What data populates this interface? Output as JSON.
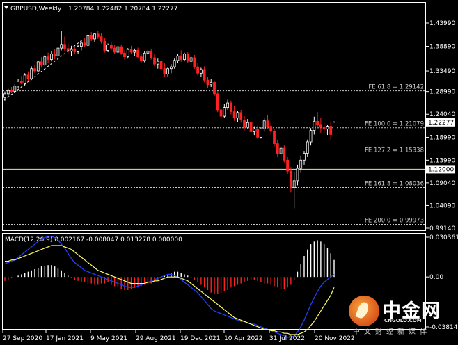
{
  "header": {
    "symbol_timeframe": "GBPUSD,Weekly",
    "ohlc": "1.20784 1.22482 1.20784 1.22277"
  },
  "price_axis": {
    "ticks": [
      "1.43990",
      "1.38890",
      "1.33490",
      "1.28990",
      "1.24040",
      "1.18990",
      "1.13990",
      "1.09040",
      "1.04090",
      "0.99140"
    ],
    "current_price_label": "1.22277",
    "line_label": "1.12000"
  },
  "fe_levels": [
    {
      "label": "FE 61.8 = 1.29142",
      "price": 1.29142
    },
    {
      "label": "FE 100.0 = 1.21079",
      "price": 1.21079
    },
    {
      "label": "FE 127.2 = 1.15338",
      "price": 1.15338
    },
    {
      "label": "FE 161.8 = 1.08036",
      "price": 1.08036
    },
    {
      "label": "FE 200.0 = 0.99973",
      "price": 0.99973
    }
  ],
  "horizontal_line": {
    "price": 1.12,
    "color": "#f4e2a0"
  },
  "macd": {
    "label": "MACD(12,26,9) 0.002167 -0.008047 0.013278 0.000000",
    "ticks": [
      "0.030361",
      "0.00",
      "-0.038141"
    ]
  },
  "time_axis": {
    "labels": [
      "27 Sep 2020",
      "17 Jan 2021",
      "9 May 2021",
      "29 Aug 2021",
      "19 Dec 2021",
      "10 Apr 2022",
      "31 Jul 2022",
      "20 Nov 2022"
    ]
  },
  "watermark": {
    "name": "中金网",
    "domain": "CNGOLD.COM",
    "tagline": "中文财经新媒体"
  },
  "colors": {
    "bull": "#ffffff",
    "bear": "#ff2020",
    "signal": "#ffff66",
    "macd_line": "#2040ff",
    "fe_line": "#c8c8c8",
    "grid": "#ffffff"
  },
  "chart_data": {
    "type": "candlestick",
    "candles": [
      [
        1.277,
        1.29,
        1.27,
        1.285
      ],
      [
        1.285,
        1.296,
        1.28,
        1.292
      ],
      [
        1.292,
        1.3,
        1.287,
        1.29
      ],
      [
        1.29,
        1.306,
        1.286,
        1.302
      ],
      [
        1.302,
        1.318,
        1.297,
        1.312
      ],
      [
        1.312,
        1.324,
        1.305,
        1.308
      ],
      [
        1.308,
        1.33,
        1.303,
        1.326
      ],
      [
        1.326,
        1.334,
        1.312,
        1.318
      ],
      [
        1.318,
        1.345,
        1.315,
        1.34
      ],
      [
        1.34,
        1.349,
        1.33,
        1.335
      ],
      [
        1.335,
        1.358,
        1.332,
        1.355
      ],
      [
        1.355,
        1.365,
        1.342,
        1.348
      ],
      [
        1.348,
        1.37,
        1.345,
        1.366
      ],
      [
        1.366,
        1.375,
        1.352,
        1.36
      ],
      [
        1.36,
        1.378,
        1.356,
        1.372
      ],
      [
        1.372,
        1.383,
        1.36,
        1.368
      ],
      [
        1.368,
        1.388,
        1.364,
        1.385
      ],
      [
        1.385,
        1.422,
        1.38,
        1.393
      ],
      [
        1.393,
        1.41,
        1.378,
        1.384
      ],
      [
        1.384,
        1.395,
        1.372,
        1.378
      ],
      [
        1.378,
        1.39,
        1.368,
        1.382
      ],
      [
        1.382,
        1.388,
        1.373,
        1.377
      ],
      [
        1.377,
        1.392,
        1.372,
        1.389
      ],
      [
        1.389,
        1.4,
        1.38,
        1.396
      ],
      [
        1.396,
        1.408,
        1.388,
        1.391
      ],
      [
        1.391,
        1.415,
        1.388,
        1.412
      ],
      [
        1.412,
        1.42,
        1.4,
        1.405
      ],
      [
        1.405,
        1.418,
        1.398,
        1.416
      ],
      [
        1.416,
        1.422,
        1.405,
        1.41
      ],
      [
        1.41,
        1.418,
        1.395,
        1.4
      ],
      [
        1.4,
        1.408,
        1.375,
        1.38
      ],
      [
        1.38,
        1.395,
        1.376,
        1.392
      ],
      [
        1.392,
        1.398,
        1.38,
        1.385
      ],
      [
        1.385,
        1.392,
        1.372,
        1.376
      ],
      [
        1.376,
        1.39,
        1.372,
        1.388
      ],
      [
        1.388,
        1.392,
        1.37,
        1.374
      ],
      [
        1.374,
        1.38,
        1.36,
        1.366
      ],
      [
        1.366,
        1.385,
        1.362,
        1.382
      ],
      [
        1.382,
        1.39,
        1.372,
        1.376
      ],
      [
        1.376,
        1.384,
        1.368,
        1.38
      ],
      [
        1.38,
        1.386,
        1.362,
        1.366
      ],
      [
        1.366,
        1.372,
        1.352,
        1.358
      ],
      [
        1.358,
        1.378,
        1.354,
        1.374
      ],
      [
        1.374,
        1.384,
        1.368,
        1.378
      ],
      [
        1.378,
        1.382,
        1.36,
        1.364
      ],
      [
        1.364,
        1.372,
        1.345,
        1.35
      ],
      [
        1.35,
        1.362,
        1.34,
        1.356
      ],
      [
        1.356,
        1.36,
        1.335,
        1.34
      ],
      [
        1.34,
        1.352,
        1.322,
        1.328
      ],
      [
        1.328,
        1.344,
        1.323,
        1.34
      ],
      [
        1.34,
        1.35,
        1.33,
        1.344
      ],
      [
        1.344,
        1.362,
        1.34,
        1.358
      ],
      [
        1.358,
        1.372,
        1.352,
        1.368
      ],
      [
        1.368,
        1.38,
        1.355,
        1.36
      ],
      [
        1.36,
        1.375,
        1.356,
        1.372
      ],
      [
        1.372,
        1.376,
        1.352,
        1.356
      ],
      [
        1.356,
        1.368,
        1.348,
        1.364
      ],
      [
        1.364,
        1.37,
        1.34,
        1.344
      ],
      [
        1.344,
        1.352,
        1.325,
        1.33
      ],
      [
        1.33,
        1.342,
        1.322,
        1.338
      ],
      [
        1.338,
        1.345,
        1.31,
        1.315
      ],
      [
        1.315,
        1.322,
        1.298,
        1.305
      ],
      [
        1.305,
        1.318,
        1.3,
        1.31
      ],
      [
        1.31,
        1.314,
        1.28,
        1.285
      ],
      [
        1.285,
        1.29,
        1.245,
        1.25
      ],
      [
        1.25,
        1.258,
        1.23,
        1.236
      ],
      [
        1.236,
        1.262,
        1.232,
        1.255
      ],
      [
        1.255,
        1.272,
        1.25,
        1.265
      ],
      [
        1.265,
        1.27,
        1.24,
        1.246
      ],
      [
        1.246,
        1.258,
        1.226,
        1.232
      ],
      [
        1.232,
        1.248,
        1.224,
        1.244
      ],
      [
        1.244,
        1.25,
        1.222,
        1.228
      ],
      [
        1.228,
        1.236,
        1.205,
        1.212
      ],
      [
        1.212,
        1.23,
        1.208,
        1.222
      ],
      [
        1.222,
        1.226,
        1.196,
        1.202
      ],
      [
        1.202,
        1.214,
        1.195,
        1.208
      ],
      [
        1.208,
        1.216,
        1.186,
        1.19
      ],
      [
        1.19,
        1.212,
        1.187,
        1.208
      ],
      [
        1.208,
        1.232,
        1.202,
        1.226
      ],
      [
        1.226,
        1.238,
        1.208,
        1.214
      ],
      [
        1.214,
        1.222,
        1.196,
        1.203
      ],
      [
        1.203,
        1.208,
        1.17,
        1.176
      ],
      [
        1.176,
        1.185,
        1.148,
        1.154
      ],
      [
        1.154,
        1.17,
        1.14,
        1.166
      ],
      [
        1.166,
        1.172,
        1.135,
        1.14
      ],
      [
        1.14,
        1.148,
        1.11,
        1.116
      ],
      [
        1.116,
        1.125,
        1.07,
        1.08
      ],
      [
        1.08,
        1.115,
        1.035,
        1.095
      ],
      [
        1.095,
        1.13,
        1.085,
        1.122
      ],
      [
        1.122,
        1.15,
        1.112,
        1.14
      ],
      [
        1.14,
        1.16,
        1.13,
        1.155
      ],
      [
        1.155,
        1.185,
        1.148,
        1.18
      ],
      [
        1.18,
        1.21,
        1.172,
        1.205
      ],
      [
        1.205,
        1.235,
        1.196,
        1.225
      ],
      [
        1.225,
        1.245,
        1.21,
        1.218
      ],
      [
        1.218,
        1.232,
        1.2,
        1.212
      ],
      [
        1.212,
        1.222,
        1.198,
        1.208
      ],
      [
        1.208,
        1.218,
        1.195,
        1.214
      ],
      [
        1.214,
        1.225,
        1.185,
        1.196
      ],
      [
        1.20784,
        1.22482,
        1.20784,
        1.22277
      ]
    ],
    "macd_histogram": [
      -0.003,
      -0.002,
      -0.001,
      0.0,
      0.001,
      0.002,
      0.003,
      0.004,
      0.005,
      0.006,
      0.007,
      0.008,
      0.008,
      0.009,
      0.009,
      0.008,
      0.007,
      0.005,
      0.003,
      0.001,
      -0.001,
      -0.002,
      -0.003,
      -0.004,
      -0.004,
      -0.005,
      -0.005,
      -0.006,
      -0.006,
      -0.005,
      -0.005,
      -0.004,
      -0.006,
      -0.007,
      -0.008,
      -0.009,
      -0.01,
      -0.01,
      -0.009,
      -0.008,
      -0.008,
      -0.007,
      -0.006,
      -0.006,
      -0.005,
      -0.004,
      -0.002,
      -0.001,
      0.001,
      0.002,
      0.003,
      0.004,
      0.004,
      0.003,
      0.002,
      0.001,
      -0.001,
      -0.002,
      -0.004,
      -0.006,
      -0.008,
      -0.01,
      -0.012,
      -0.013,
      -0.013,
      -0.012,
      -0.011,
      -0.01,
      -0.008,
      -0.007,
      -0.006,
      -0.005,
      -0.004,
      -0.003,
      -0.002,
      -0.002,
      -0.003,
      -0.004,
      -0.005,
      -0.005,
      -0.006,
      -0.007,
      -0.008,
      -0.009,
      -0.009,
      -0.008,
      -0.006,
      -0.002,
      0.004,
      0.01,
      0.016,
      0.021,
      0.025,
      0.027,
      0.028,
      0.027,
      0.025,
      0.022,
      0.018,
      0.013
    ],
    "macd_line": [
      0.01,
      0.011,
      0.012,
      0.013,
      0.015,
      0.017,
      0.019,
      0.021,
      0.023,
      0.025,
      0.027,
      0.029,
      0.03,
      0.031,
      0.031,
      0.03,
      0.028,
      0.025,
      0.022,
      0.018,
      0.014,
      0.011,
      0.009,
      0.007,
      0.005,
      0.004,
      0.003,
      0.002,
      0.001,
      0.0,
      -0.001,
      -0.002,
      -0.003,
      -0.004,
      -0.005,
      -0.006,
      -0.007,
      -0.008,
      -0.008,
      -0.008,
      -0.007,
      -0.006,
      -0.005,
      -0.004,
      -0.003,
      -0.002,
      -0.001,
      0.0,
      0.001,
      0.002,
      0.002,
      0.001,
      0.0,
      -0.002,
      -0.004,
      -0.006,
      -0.008,
      -0.01,
      -0.012,
      -0.015,
      -0.018,
      -0.021,
      -0.024,
      -0.026,
      -0.027,
      -0.028,
      -0.029,
      -0.03,
      -0.031,
      -0.032,
      -0.033,
      -0.034,
      -0.034,
      -0.035,
      -0.036,
      -0.036,
      -0.037,
      -0.038,
      -0.039,
      -0.04,
      -0.041,
      -0.042,
      -0.043,
      -0.044,
      -0.045,
      -0.046,
      -0.046,
      -0.045,
      -0.042,
      -0.038,
      -0.033,
      -0.027,
      -0.021,
      -0.016,
      -0.011,
      -0.007,
      -0.004,
      -0.002,
      0.0,
      0.002
    ],
    "signal_line": [
      0.012,
      0.012,
      0.013,
      0.013,
      0.014,
      0.015,
      0.016,
      0.017,
      0.018,
      0.019,
      0.02,
      0.021,
      0.022,
      0.023,
      0.024,
      0.024,
      0.024,
      0.024,
      0.023,
      0.022,
      0.021,
      0.019,
      0.017,
      0.015,
      0.013,
      0.011,
      0.009,
      0.007,
      0.005,
      0.004,
      0.003,
      0.002,
      0.001,
      0.0,
      -0.001,
      -0.002,
      -0.003,
      -0.004,
      -0.005,
      -0.005,
      -0.005,
      -0.005,
      -0.005,
      -0.004,
      -0.004,
      -0.003,
      -0.003,
      -0.002,
      -0.001,
      0.0,
      0.0,
      0.0,
      0.0,
      -0.001,
      -0.002,
      -0.003,
      -0.005,
      -0.007,
      -0.009,
      -0.011,
      -0.013,
      -0.015,
      -0.017,
      -0.019,
      -0.021,
      -0.023,
      -0.025,
      -0.027,
      -0.029,
      -0.031,
      -0.032,
      -0.033,
      -0.034,
      -0.035,
      -0.036,
      -0.037,
      -0.038,
      -0.039,
      -0.04,
      -0.04,
      -0.041,
      -0.041,
      -0.042,
      -0.042,
      -0.043,
      -0.043,
      -0.044,
      -0.044,
      -0.044,
      -0.043,
      -0.042,
      -0.04,
      -0.037,
      -0.034,
      -0.03,
      -0.026,
      -0.022,
      -0.018,
      -0.014,
      -0.008
    ]
  }
}
